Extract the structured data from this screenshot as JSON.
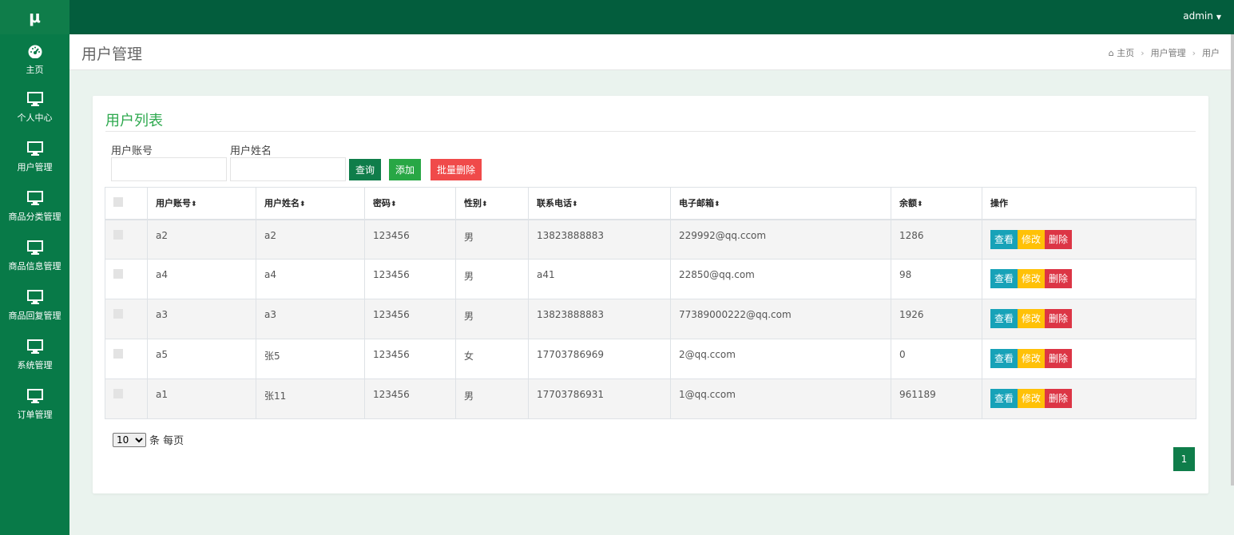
{
  "app": {
    "logo": "μ",
    "user": "admin"
  },
  "sidebar": {
    "items": [
      {
        "label": "主页",
        "icon": "dashboard-icon"
      },
      {
        "label": "个人中心",
        "icon": "monitor-icon"
      },
      {
        "label": "用户管理",
        "icon": "monitor-icon"
      },
      {
        "label": "商品分类管理",
        "icon": "monitor-icon"
      },
      {
        "label": "商品信息管理",
        "icon": "monitor-icon"
      },
      {
        "label": "商品回复管理",
        "icon": "monitor-icon"
      },
      {
        "label": "系统管理",
        "icon": "monitor-icon"
      },
      {
        "label": "订单管理",
        "icon": "monitor-icon"
      }
    ]
  },
  "header": {
    "title": "用户管理",
    "breadcrumb": [
      "主页",
      "用户管理",
      "用户"
    ]
  },
  "card": {
    "title": "用户列表",
    "filters": {
      "account_label": "用户账号",
      "account_value": "",
      "name_label": "用户姓名",
      "name_value": ""
    },
    "buttons": {
      "query": "查询",
      "add": "添加",
      "batch_delete": "批量删除"
    }
  },
  "table": {
    "columns": [
      "用户账号",
      "用户姓名",
      "密码",
      "性别",
      "联系电话",
      "电子邮箱",
      "余额",
      "操作"
    ],
    "rows": [
      [
        "a2",
        "a2",
        "123456",
        "男",
        "13823888883",
        "229992@qq.ccom",
        "1286"
      ],
      [
        "a4",
        "a4",
        "123456",
        "男",
        "a41",
        "22850@qq.com",
        "98"
      ],
      [
        "a3",
        "a3",
        "123456",
        "男",
        "13823888883",
        "77389000222@qq.com",
        "1926"
      ],
      [
        "a5",
        "张5",
        "123456",
        "女",
        "17703786969",
        "2@qq.ccom",
        "0"
      ],
      [
        "a1",
        "张11",
        "123456",
        "男",
        "17703786931",
        "1@qq.ccom",
        "961189"
      ]
    ],
    "actions": {
      "view": "查看",
      "edit": "修改",
      "delete": "删除"
    }
  },
  "pagination": {
    "page_size": "10",
    "page_size_suffix": "条 每页",
    "current_page": "1"
  },
  "colors": {
    "topbar": "#035d3d",
    "sidebar": "#087a48",
    "accent_green": "#2ea94f",
    "info": "#17a2b8",
    "warning": "#ffc107",
    "danger": "#dc3545"
  }
}
